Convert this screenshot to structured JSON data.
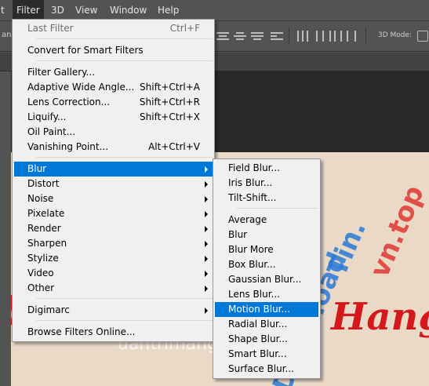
{
  "menubar": {
    "items": [
      {
        "label": "t",
        "active": false
      },
      {
        "label": "Filter",
        "active": true
      },
      {
        "label": "3D",
        "active": false
      },
      {
        "label": "View",
        "active": false
      },
      {
        "label": "Window",
        "active": false
      },
      {
        "label": "Help",
        "active": false
      }
    ]
  },
  "optionsbar": {
    "left_fragment": "an:",
    "mode_label": "3D Mode:"
  },
  "filter_menu": {
    "items": [
      {
        "label": "Last Filter",
        "shortcut": "Ctrl+F",
        "disabled": true
      },
      {
        "label": "Convert for Smart Filters",
        "shortcut": ""
      },
      {
        "label": "Filter Gallery...",
        "shortcut": ""
      },
      {
        "label": "Adaptive Wide Angle...",
        "shortcut": "Shift+Ctrl+A"
      },
      {
        "label": "Lens Correction...",
        "shortcut": "Shift+Ctrl+R"
      },
      {
        "label": "Liquify...",
        "shortcut": "Shift+Ctrl+X"
      },
      {
        "label": "Oil Paint...",
        "shortcut": ""
      },
      {
        "label": "Vanishing Point...",
        "shortcut": "Alt+Ctrl+V"
      },
      {
        "label": "Blur",
        "submenu": true,
        "highlighted": true
      },
      {
        "label": "Distort",
        "submenu": true
      },
      {
        "label": "Noise",
        "submenu": true
      },
      {
        "label": "Pixelate",
        "submenu": true
      },
      {
        "label": "Render",
        "submenu": true
      },
      {
        "label": "Sharpen",
        "submenu": true
      },
      {
        "label": "Stylize",
        "submenu": true
      },
      {
        "label": "Video",
        "submenu": true
      },
      {
        "label": "Other",
        "submenu": true
      },
      {
        "label": "Digimarc",
        "submenu": true
      },
      {
        "label": "Browse Filters Online...",
        "shortcut": ""
      }
    ]
  },
  "blur_submenu": {
    "items": [
      {
        "label": "Field Blur..."
      },
      {
        "label": "Iris Blur..."
      },
      {
        "label": "Tilt-Shift..."
      },
      {
        "label": "Average"
      },
      {
        "label": "Blur"
      },
      {
        "label": "Blur More"
      },
      {
        "label": "Box Blur..."
      },
      {
        "label": "Gaussian Blur..."
      },
      {
        "label": "Lens Blur..."
      },
      {
        "label": "Motion Blur...",
        "highlighted": true
      },
      {
        "label": "Radial Blur..."
      },
      {
        "label": "Shape Blur..."
      },
      {
        "label": "Smart Blur..."
      },
      {
        "label": "Surface Blur..."
      }
    ]
  },
  "canvas": {
    "left_letter": "Q",
    "right_word": "Hang",
    "watermark": "uantrimang",
    "watermark_blue": "Download",
    "watermark_red": "vn.top",
    "watermark_mid": "Tin."
  },
  "colors": {
    "menu_highlight": "#0078d7",
    "canvas_bg": "#ebd9c8",
    "red_text": "#d4191d",
    "panel_bg": "#535353"
  }
}
